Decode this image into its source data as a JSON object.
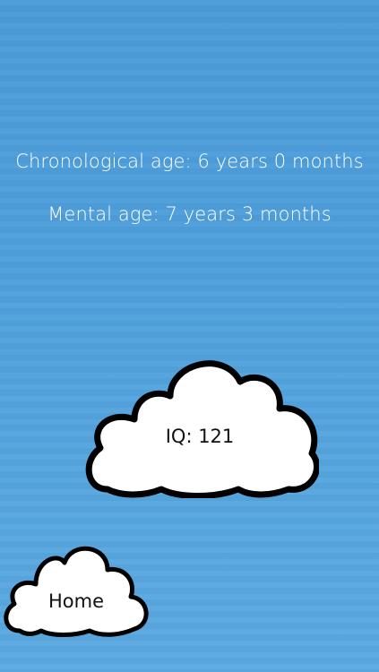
{
  "results": {
    "chronological_age": "Chronological age: 6 years 0 months",
    "mental_age": "Mental age: 7 years 3 months",
    "iq_text": "IQ: 121"
  },
  "navigation": {
    "home_label": "Home"
  },
  "colors": {
    "sky_background": "#4e9fdb",
    "cloud_fill": "#ffffff",
    "cloud_outline": "#000000",
    "info_text": "#ffffff"
  }
}
